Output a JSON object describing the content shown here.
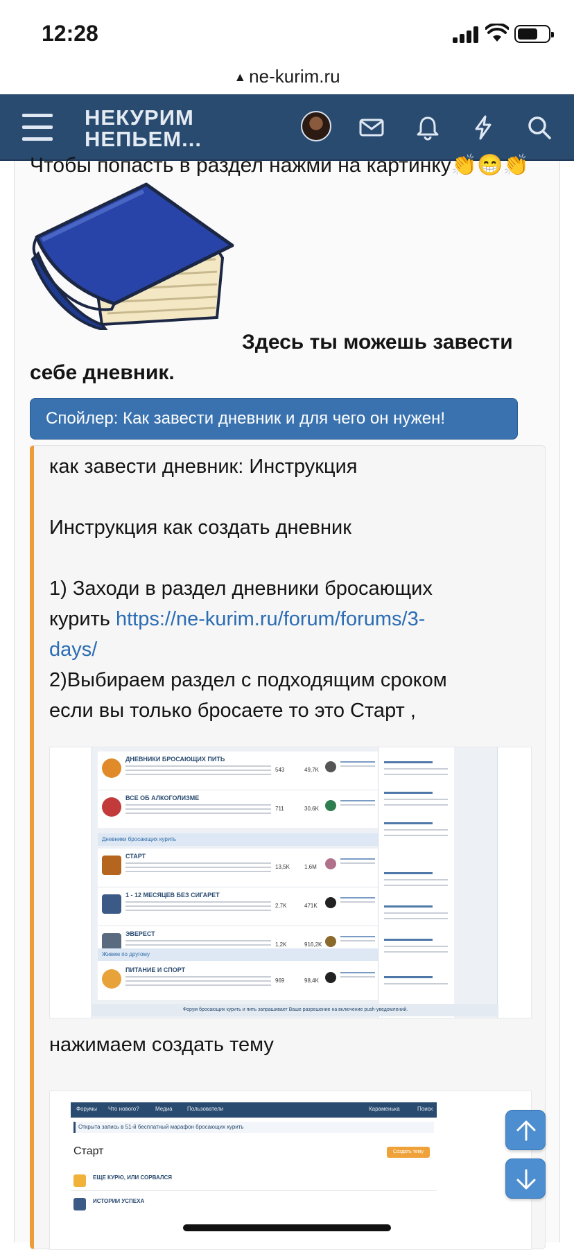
{
  "status": {
    "time": "12:28"
  },
  "browser": {
    "url": "ne-kurim.ru"
  },
  "header": {
    "logo_line1": "НЕКУРИМ",
    "logo_line2": "НЕПЬЕМ..."
  },
  "post": {
    "intro": "Чтобы попасть в раздел нажми на картинку👏😁👏",
    "book_caption": "Здесь ты можешь завести себе дневник.",
    "spoiler_button": "Спойлер: Как завести дневник и для чего он нужен!",
    "spoiler": {
      "line1": "как завести дневник: Инструкция",
      "line2": "Инструкция как создать дневник",
      "step1_text": "1) Заходи в раздел дневники бросающих курить ",
      "step1_link": "https://ne-kurim.ru/forum/forums/3-days/",
      "step2_line1": "2)Выбираем раздел с подходящим сроком",
      "step2_line2": "если вы только бросаете то это Старт ,",
      "step3": "нажимаем создать тему"
    }
  },
  "screenshot1": {
    "rows_top": [
      {
        "title": "ДНЕВНИКИ БРОСАЮЩИХ ПИТЬ",
        "threads": "543",
        "posts": "49,7K"
      },
      {
        "title": "ВСЕ ОБ АЛКОГОЛИЗМЕ",
        "threads": "711",
        "posts": "30,6K"
      }
    ],
    "group1": "Дневники бросающих курить",
    "rows_mid": [
      {
        "title": "СТАРТ",
        "threads": "13,5K",
        "posts": "1,6M"
      },
      {
        "title": "1 - 12 МЕСЯЦЕВ БЕЗ СИГАРЕТ",
        "threads": "2,7K",
        "posts": "471K"
      },
      {
        "title": "ЭВЕРЕСТ",
        "threads": "1,2K",
        "posts": "916,2K"
      }
    ],
    "group2": "Живем по другому",
    "rows_bottom": [
      {
        "title": "ПИТАНИЕ И СПОРТ",
        "threads": "969",
        "posts": "98,4K"
      }
    ],
    "footer": "Форум бросающих курить и пить запрашивает Ваше разрешение на включение push-уведомлений."
  },
  "screenshot2": {
    "nav": [
      "Форумы",
      "Что нового?",
      "Медиа",
      "Пользователи",
      "Караменька",
      "Поиск"
    ],
    "notice": "Открыта запись в 51-й бесплатный марафон бросающих курить",
    "title": "Старт",
    "create_button": "Создать тему",
    "row1": "ЕЩЕ КУРЮ, ИЛИ СОРВАЛСЯ",
    "row2": "ИСТОРИИ УСПЕХА"
  },
  "colors": {
    "header_bg": "#2a4b70",
    "spoiler_button": "#3a72b0",
    "accent_border": "#ec9c3b",
    "link": "#2b6cb3"
  },
  "icons": [
    "menu-icon",
    "avatar",
    "mail-icon",
    "bell-icon",
    "lightning-icon",
    "search-icon",
    "arrow-up-icon",
    "arrow-down-icon"
  ]
}
